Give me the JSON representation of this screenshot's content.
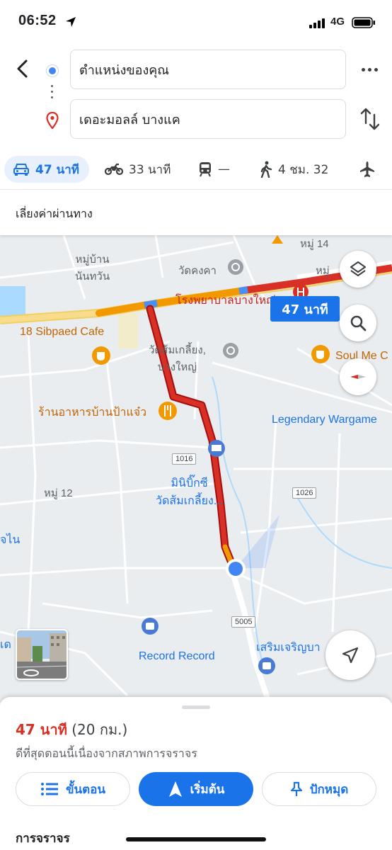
{
  "status_bar": {
    "time": "06:52",
    "network": "4G"
  },
  "directions": {
    "origin": "ตำแหน่งของคุณ",
    "destination": "เดอะมอลล์ บางแค"
  },
  "travel_modes": [
    {
      "mode": "drive",
      "label": "47 นาที",
      "active": true
    },
    {
      "mode": "motorcycle",
      "label": "33 นาที"
    },
    {
      "mode": "transit",
      "label": "—"
    },
    {
      "mode": "walk",
      "label": "4 ชม. 32"
    },
    {
      "mode": "flight",
      "label": ""
    }
  ],
  "options": {
    "avoid_tolls": "เลี่ยงค่าผ่านทาง"
  },
  "map": {
    "route_callout": "47 นาที",
    "labels": {
      "village_nantawan": "หมู่บ้าน\nนันทวัน",
      "wat_khongkha": "วัดคงคา",
      "moo14": "หมู่ 14",
      "moo_right": "หมู่",
      "hospital": "โรงพยาบาลบางใหญ่",
      "cafe18": "18 Sibpaed Cafe",
      "wat_som": "วัดส้มเกลี้ยง,\nบางใหญ่",
      "soul_cafe": "Soul Me C",
      "restaurant": "ร้านอาหารบ้านป้าแจ๋ว",
      "legendary": "Legendary Wargame",
      "minibigc": "มินิบิ๊กซี\nวัดส้มเกลี้ยง...",
      "moo12": "หมู่ 12",
      "left_text": "จไน",
      "left_text2": "เด",
      "record": "Record Record",
      "serm": "เสริมเจริญบา"
    },
    "road_numbers": [
      "1016",
      "1026",
      "5005"
    ],
    "colors": {
      "route_red": "#d93025",
      "route_orange": "#f29900",
      "highway": "#f6d77a",
      "accent": "#1a73e8"
    }
  },
  "bottom_sheet": {
    "duration": "47 นาที",
    "distance": "(20 กม.)",
    "note": "ดีที่สุดตอนนี้เนื่องจากสภาพการจราจร",
    "buttons": {
      "steps": "ขั้นตอน",
      "start": "เริ่มต้น",
      "pin": "ปักหมุด"
    },
    "traffic_heading": "การจราจร"
  }
}
